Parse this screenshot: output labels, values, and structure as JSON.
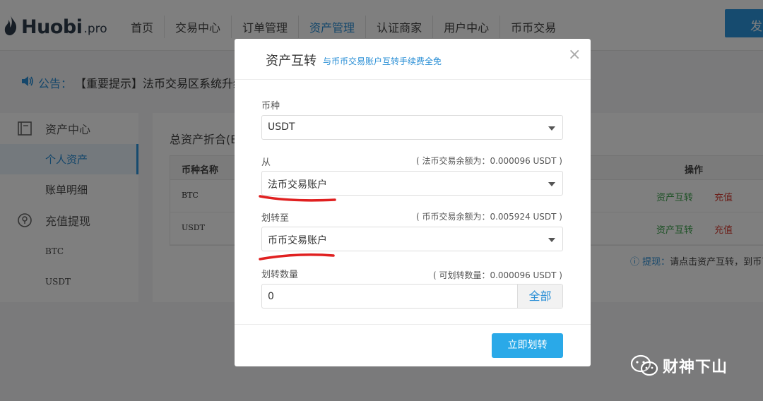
{
  "header": {
    "logo_text": "Huobi",
    "logo_suffix": ".pro",
    "nav": [
      "首页",
      "交易中心",
      "订单管理",
      "资产管理",
      "认证商家",
      "用户中心",
      "币币交易"
    ],
    "post_button": "发"
  },
  "notice": {
    "label": "公告：",
    "text": "【重要提示】法币交易区系统升级"
  },
  "sidebar": {
    "group1": "资产中心",
    "items1": [
      "个人资产",
      "账单明细"
    ],
    "group2": "充值提现",
    "items2": [
      "BTC",
      "USDT"
    ]
  },
  "content": {
    "total_label": "总资产折合(B",
    "col_name": "币种名称",
    "col_ops": "操作",
    "rows": [
      {
        "coin": "BTC",
        "action1": "资产互转",
        "action2": "充值"
      },
      {
        "coin": "USDT",
        "action1": "资产互转",
        "action2": "充值"
      }
    ],
    "tip_label": "提现：",
    "tip_text": "请点击资产互转，到币币交"
  },
  "modal": {
    "title": "资产互转",
    "subtitle": "与币币交易账户互转手续费全免",
    "coin_label": "币种",
    "coin_value": "USDT",
    "from_label": "从",
    "from_hint": "( 法币交易余额为：0.000096 USDT )",
    "from_value": "法币交易账户",
    "to_label": "划转至",
    "to_hint": "( 币币交易余额为：0.005924 USDT )",
    "to_value": "币币交易账户",
    "qty_label": "划转数量",
    "qty_hint": "( 可划转数量：0.000096 USDT )",
    "qty_value": "0",
    "all_button": "全部",
    "submit": "立即划转"
  },
  "watermark": {
    "text": "财神下山"
  },
  "colors": {
    "accent": "#2a8fd6",
    "button": "#2aa9e8",
    "green_action": "#3aa34b",
    "red_action": "#d9453b",
    "underline": "#e02020"
  }
}
